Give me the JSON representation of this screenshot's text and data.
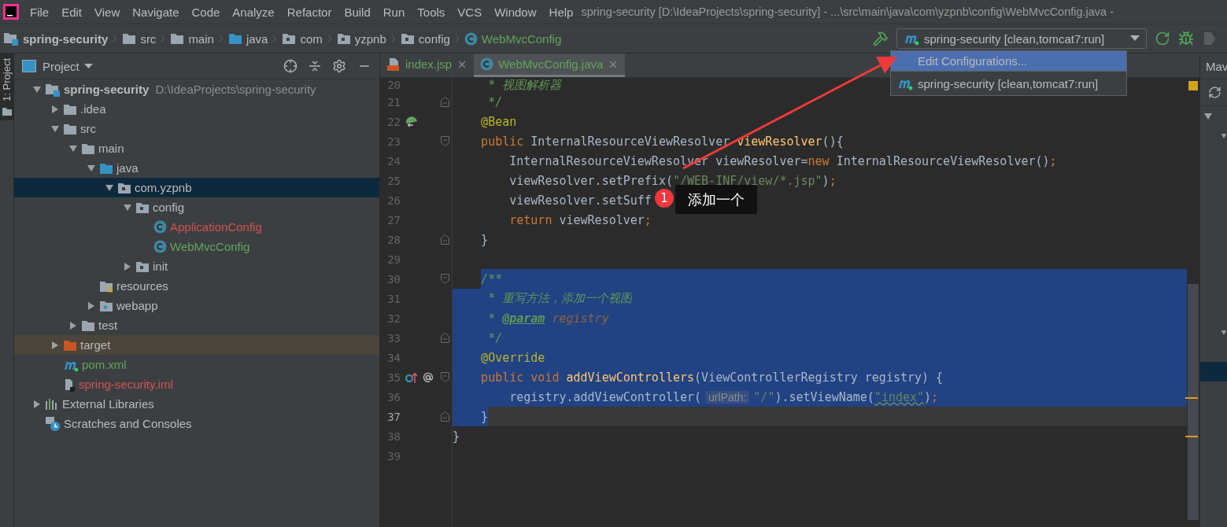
{
  "menu_bar": {
    "items": [
      "File",
      "Edit",
      "View",
      "Navigate",
      "Code",
      "Analyze",
      "Refactor",
      "Build",
      "Run",
      "Tools",
      "VCS",
      "Window",
      "Help"
    ],
    "title": "spring-security [D:\\IdeaProjects\\spring-security] - ...\\src\\main\\java\\com\\yzpnb\\config\\WebMvcConfig.java -"
  },
  "nav_bar": {
    "breadcrumbs": [
      {
        "label": "spring-security",
        "kind": "module",
        "color": "#bbbbbb"
      },
      {
        "label": "src",
        "kind": "folder",
        "color": "#bbbbbb"
      },
      {
        "label": "main",
        "kind": "folder",
        "color": "#bbbbbb"
      },
      {
        "label": "java",
        "kind": "source-folder",
        "color": "#bbbbbb"
      },
      {
        "label": "com",
        "kind": "package",
        "color": "#bbbbbb"
      },
      {
        "label": "yzpnb",
        "kind": "package",
        "color": "#bbbbbb"
      },
      {
        "label": "config",
        "kind": "package",
        "color": "#bbbbbb"
      },
      {
        "label": "WebMvcConfig",
        "kind": "class",
        "color": "#62a35b"
      }
    ],
    "run_config": {
      "label": "spring-security [clean,tomcat7:run]"
    }
  },
  "run_config_menu": {
    "items": [
      {
        "label": "Edit Configurations...",
        "kind": "action",
        "selected": true
      },
      {
        "label": "spring-security [clean,tomcat7:run]",
        "kind": "configuration",
        "selected": false
      }
    ]
  },
  "tool_stripe": {
    "tabs": [
      {
        "label": "1: Project",
        "selected": true
      }
    ]
  },
  "project_panel": {
    "title": "Project",
    "tree": [
      {
        "name": "spring-security",
        "path": "D:\\IdeaProjects\\spring-security",
        "kind": "module",
        "color": "#bbbbbb",
        "expanded": true,
        "selected": false,
        "children": [
          {
            "name": ".idea",
            "kind": "folder",
            "color": "#bbbbbb",
            "expanded": false,
            "selected": false
          },
          {
            "name": "src",
            "kind": "folder",
            "color": "#bbbbbb",
            "expanded": true,
            "selected": false,
            "children": [
              {
                "name": "main",
                "kind": "folder",
                "color": "#bbbbbb",
                "expanded": true,
                "selected": false,
                "children": [
                  {
                    "name": "java",
                    "kind": "source-folder",
                    "color": "#bbbbbb",
                    "expanded": true,
                    "selected": false,
                    "children": [
                      {
                        "name": "com.yzpnb",
                        "kind": "package",
                        "color": "#bbbbbb",
                        "expanded": true,
                        "selected": true,
                        "children": [
                          {
                            "name": "config",
                            "kind": "package",
                            "color": "#bbbbbb",
                            "expanded": true,
                            "selected": false,
                            "children": [
                              {
                                "name": "ApplicationConfig",
                                "kind": "class",
                                "color": "#d25252",
                                "selected": false
                              },
                              {
                                "name": "WebMvcConfig",
                                "kind": "class",
                                "color": "#62a35b",
                                "selected": false
                              }
                            ]
                          },
                          {
                            "name": "init",
                            "kind": "package",
                            "color": "#bbbbbb",
                            "expanded": false,
                            "selected": false
                          }
                        ]
                      }
                    ]
                  },
                  {
                    "name": "resources",
                    "kind": "resources-folder",
                    "color": "#bbbbbb",
                    "selected": false
                  },
                  {
                    "name": "webapp",
                    "kind": "web-folder",
                    "color": "#bbbbbb",
                    "expanded": false,
                    "selected": false
                  }
                ]
              },
              {
                "name": "test",
                "kind": "folder",
                "color": "#bbbbbb",
                "expanded": false,
                "selected": false
              }
            ]
          },
          {
            "name": "target",
            "kind": "excluded-folder",
            "color": "#bbbbbb",
            "expanded": false,
            "selected": false,
            "excluded": true
          },
          {
            "name": "pom.xml",
            "kind": "maven",
            "color": "#62a35b",
            "selected": false
          },
          {
            "name": "spring-security.iml",
            "kind": "iml",
            "color": "#d25252",
            "selected": false
          }
        ]
      },
      {
        "name": "External Libraries",
        "kind": "libraries",
        "color": "#bbbbbb",
        "expanded": false,
        "selected": false
      },
      {
        "name": "Scratches and Consoles",
        "kind": "scratches",
        "color": "#bbbbbb",
        "selected": false
      }
    ]
  },
  "editor": {
    "tabs": [
      {
        "label": "index.jsp",
        "kind": "jsp",
        "color": "#62a35b",
        "selected": false
      },
      {
        "label": "WebMvcConfig.java",
        "kind": "class",
        "color": "#62a35b",
        "selected": true
      }
    ],
    "lines": [
      {
        "kind": "block",
        "children": [
          {
            "kind": "line",
            "number": "20",
            "selected": false,
            "tokens": [
              {
                "kind": "doc",
                "text": " * 视图解析器"
              }
            ]
          },
          {
            "kind": "line",
            "number": "21",
            "selected": false,
            "tokens": [
              {
                "kind": "doc",
                "text": " */"
              }
            ]
          },
          {
            "kind": "line",
            "number": "22",
            "selected": false,
            "tokens": [
              {
                "kind": "annotation",
                "text": "@Bean"
              }
            ]
          },
          {
            "kind": "line",
            "number": "23",
            "selected": false,
            "tokens": [
              {
                "kind": "keyword",
                "text": "public"
              },
              {
                "kind": "plain",
                "text": " InternalResourceViewResolver "
              },
              {
                "kind": "method",
                "text": "viewResolver"
              },
              {
                "kind": "plain",
                "text": "(){"
              }
            ],
            "children": [
              {
                "kind": "line",
                "number": "24",
                "selected": false,
                "tokens": [
                  {
                    "kind": "plain",
                    "text": "InternalResourceViewResolver viewResolver="
                  },
                  {
                    "kind": "keyword",
                    "text": "new"
                  },
                  {
                    "kind": "plain",
                    "text": " InternalResourceViewResolver()"
                  },
                  {
                    "kind": "punct",
                    "text": ";"
                  }
                ]
              },
              {
                "kind": "line",
                "number": "25",
                "selected": false,
                "tokens": [
                  {
                    "kind": "plain",
                    "text": "viewResolver.setPrefix("
                  },
                  {
                    "kind": "string",
                    "text": "\"/WEB-INF/view/*.jsp\""
                  },
                  {
                    "kind": "plain",
                    "text": ")"
                  },
                  {
                    "kind": "punct",
                    "text": ";"
                  }
                ]
              },
              {
                "kind": "line",
                "number": "26",
                "selected": false,
                "tokens": [
                  {
                    "kind": "plain",
                    "text": "viewResolver.setSuff"
                  }
                ]
              },
              {
                "kind": "line",
                "number": "27",
                "selected": false,
                "tokens": [
                  {
                    "kind": "keyword",
                    "text": "return"
                  },
                  {
                    "kind": "plain",
                    "text": " viewResolver"
                  },
                  {
                    "kind": "punct",
                    "text": ";"
                  }
                ]
              }
            ]
          },
          {
            "kind": "line",
            "number": "28",
            "selected": false,
            "tokens": [
              {
                "kind": "plain",
                "text": "}"
              }
            ]
          },
          {
            "kind": "line",
            "number": "29",
            "selected": false
          },
          {
            "kind": "line",
            "number": "30",
            "selected": true,
            "tokens": [
              {
                "kind": "doc",
                "text": "/**"
              }
            ]
          },
          {
            "kind": "line",
            "number": "31",
            "selected": true,
            "tokens": [
              {
                "kind": "doc",
                "text": " * 重写方法，添加一个视图"
              }
            ]
          },
          {
            "kind": "line",
            "number": "32",
            "selected": true,
            "tokens": [
              {
                "kind": "doc",
                "text": " * "
              },
              {
                "kind": "doctag",
                "text": "@param"
              },
              {
                "kind": "docparam",
                "text": " registry"
              }
            ]
          },
          {
            "kind": "line",
            "number": "33",
            "selected": true,
            "tokens": [
              {
                "kind": "doc",
                "text": " */"
              }
            ]
          },
          {
            "kind": "line",
            "number": "34",
            "selected": true,
            "tokens": [
              {
                "kind": "annotation",
                "text": "@Override"
              }
            ]
          },
          {
            "kind": "line",
            "number": "35",
            "selected": true,
            "tokens": [
              {
                "kind": "keyword",
                "text": "public void "
              },
              {
                "kind": "method",
                "text": "addViewControllers"
              },
              {
                "kind": "plain",
                "text": "(ViewControllerRegistry registry) {"
              }
            ],
            "children": [
              {
                "kind": "line",
                "number": "36",
                "selected": true,
                "tokens": [
                  {
                    "kind": "plain",
                    "text": "registry.addViewController("
                  },
                  {
                    "kind": "hint",
                    "text": "urlPath:"
                  },
                  {
                    "kind": "string",
                    "text": "\"/\""
                  },
                  {
                    "kind": "plain",
                    "text": ").setViewName("
                  },
                  {
                    "kind": "typo",
                    "text": "\"index\""
                  },
                  {
                    "kind": "plain",
                    "text": ")"
                  },
                  {
                    "kind": "punct",
                    "text": ";"
                  }
                ]
              }
            ]
          },
          {
            "kind": "line",
            "number": "37",
            "selected": true,
            "current": true,
            "tokens": [
              {
                "kind": "plain",
                "text": "}"
              }
            ]
          }
        ]
      },
      {
        "kind": "line",
        "number": "38",
        "selected": false,
        "tokens": [
          {
            "kind": "plain",
            "text": "}"
          }
        ]
      },
      {
        "kind": "line",
        "number": "39",
        "selected": false
      }
    ]
  },
  "maven_panel": {
    "title": "Mav",
    "rows": [
      {
        "expanded": true,
        "selected": false
      },
      {
        "expanded": true,
        "selected": false
      },
      {
        "selected": false
      },
      {
        "selected": false
      },
      {
        "selected": false
      },
      {
        "selected": false
      },
      {
        "selected": false
      },
      {
        "selected": false
      },
      {
        "selected": false
      },
      {
        "selected": false
      },
      {
        "selected": false
      },
      {
        "expanded": true,
        "selected": false
      },
      {
        "selected": false
      },
      {
        "selected": true
      }
    ]
  },
  "annotation": {
    "badge": "1",
    "note": "添加一个"
  }
}
